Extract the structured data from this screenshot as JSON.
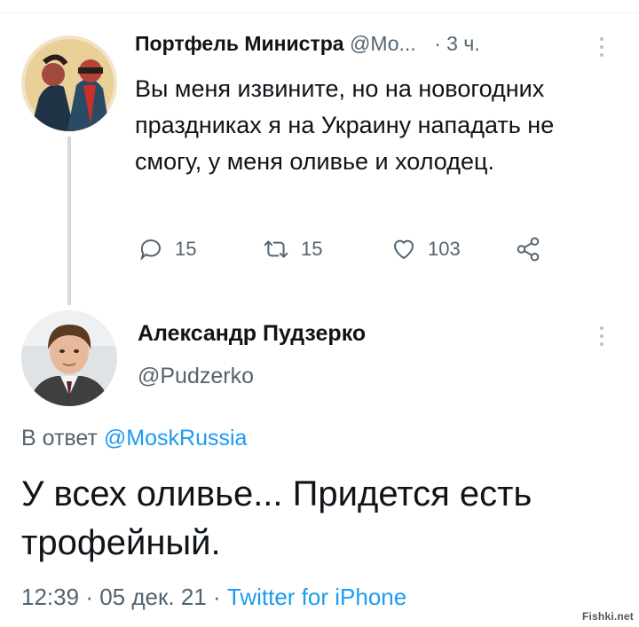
{
  "tweet1": {
    "name": "Портфель Министра",
    "handle": "@Мо...",
    "separator": "·",
    "time": "3 ч.",
    "text": "Вы меня извините, но на новогодних праздниках я на Украину нападать не смогу, у меня оливье и холодец.",
    "replies": "15",
    "retweets": "15",
    "likes": "103",
    "avatar_icon": "caricature-avatar"
  },
  "tweet2": {
    "name": "Александр Пудзерко",
    "handle": "@Pudzerko",
    "reply_prefix": "В ответ",
    "reply_mention": "@MoskRussia",
    "text": "У всех оливье... Придется есть трофейный.",
    "time": "12:39",
    "dot1": "·",
    "date": "05 дек. 21",
    "dot2": "·",
    "source": "Twitter for iPhone",
    "avatar_icon": "person-photo-avatar"
  },
  "watermark": "Fishki.net",
  "colors": {
    "text": "#0f1419",
    "secondary": "#536471",
    "link": "#1d9bf0",
    "thread_line": "#cfd9de"
  }
}
